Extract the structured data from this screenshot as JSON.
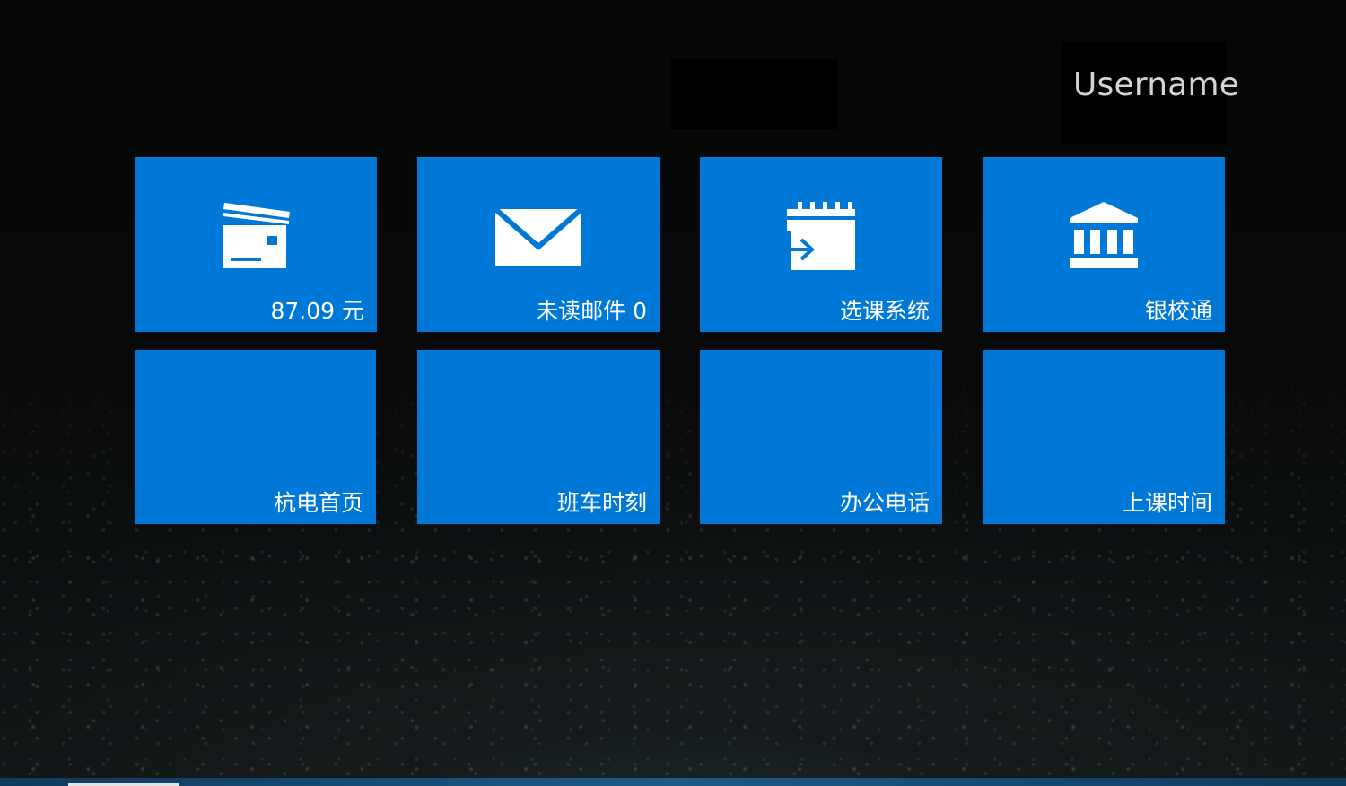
{
  "header": {
    "username": "Username"
  },
  "tiles": [
    {
      "label": "87.09 元",
      "icon": "card-icon"
    },
    {
      "label": "未读邮件 0",
      "icon": "mail-icon"
    },
    {
      "label": "选课系统",
      "icon": "calendar-enter-icon"
    },
    {
      "label": "银校通",
      "icon": "bank-icon"
    },
    {
      "label": "杭电首页"
    },
    {
      "label": "班车时刻"
    },
    {
      "label": "办公电话"
    },
    {
      "label": "上课时间"
    }
  ],
  "colors": {
    "tile": "#0078d7",
    "background": "#070808"
  }
}
